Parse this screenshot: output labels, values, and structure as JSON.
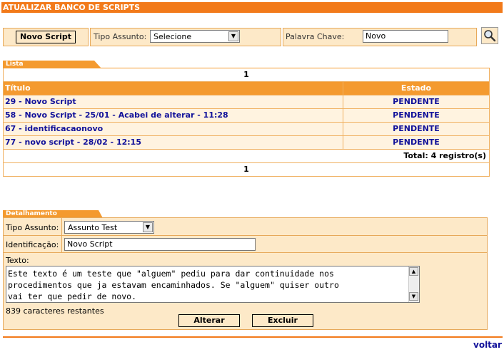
{
  "header": {
    "title": "ATUALIZAR BANCO DE SCRIPTS"
  },
  "filter": {
    "new_script_label": "Novo Script",
    "tipo_assunto_label": "Tipo Assunto:",
    "tipo_assunto_value": "Selecione",
    "palavra_chave_label": "Palavra Chave:",
    "palavra_chave_value": "Novo",
    "search_icon": "magnifier-icon"
  },
  "lista": {
    "tab_label": "Lista",
    "pager_top": "1",
    "pager_bottom": "1",
    "columns": [
      "Título",
      "Estado"
    ],
    "rows": [
      {
        "title": "29 - Novo Script",
        "status": "PENDENTE"
      },
      {
        "title": "58 - Novo Script - 25/01 - Acabei de alterar - 11:28",
        "status": "PENDENTE"
      },
      {
        "title": "67 - identificacaonovo",
        "status": "PENDENTE"
      },
      {
        "title": "77 - novo script - 28/02 - 12:15",
        "status": "PENDENTE"
      }
    ],
    "total": "Total: 4 registro(s)"
  },
  "detalhamento": {
    "tab_label": "Detalhamento",
    "tipo_assunto_label": "Tipo Assunto:",
    "tipo_assunto_value": "Assunto Test",
    "identificacao_label": "Identificação:",
    "identificacao_value": "Novo Script",
    "texto_label": "Texto:",
    "texto_value": "Este texto é um teste que \"alguem\" pediu para dar continuidade nos\nprocedimentos que ja estavam encaminhados. Se \"alguem\" quiser outro\nvai ter que pedir de novo.",
    "chars_remaining": "839 caracteres restantes",
    "alterar_label": "Alterar",
    "excluir_label": "Excluir"
  },
  "footer": {
    "voltar_label": "voltar"
  },
  "colors": {
    "accent": "#f27a1a",
    "tab": "#f49a2f",
    "panel": "#fde9c8",
    "link": "#11119a"
  }
}
